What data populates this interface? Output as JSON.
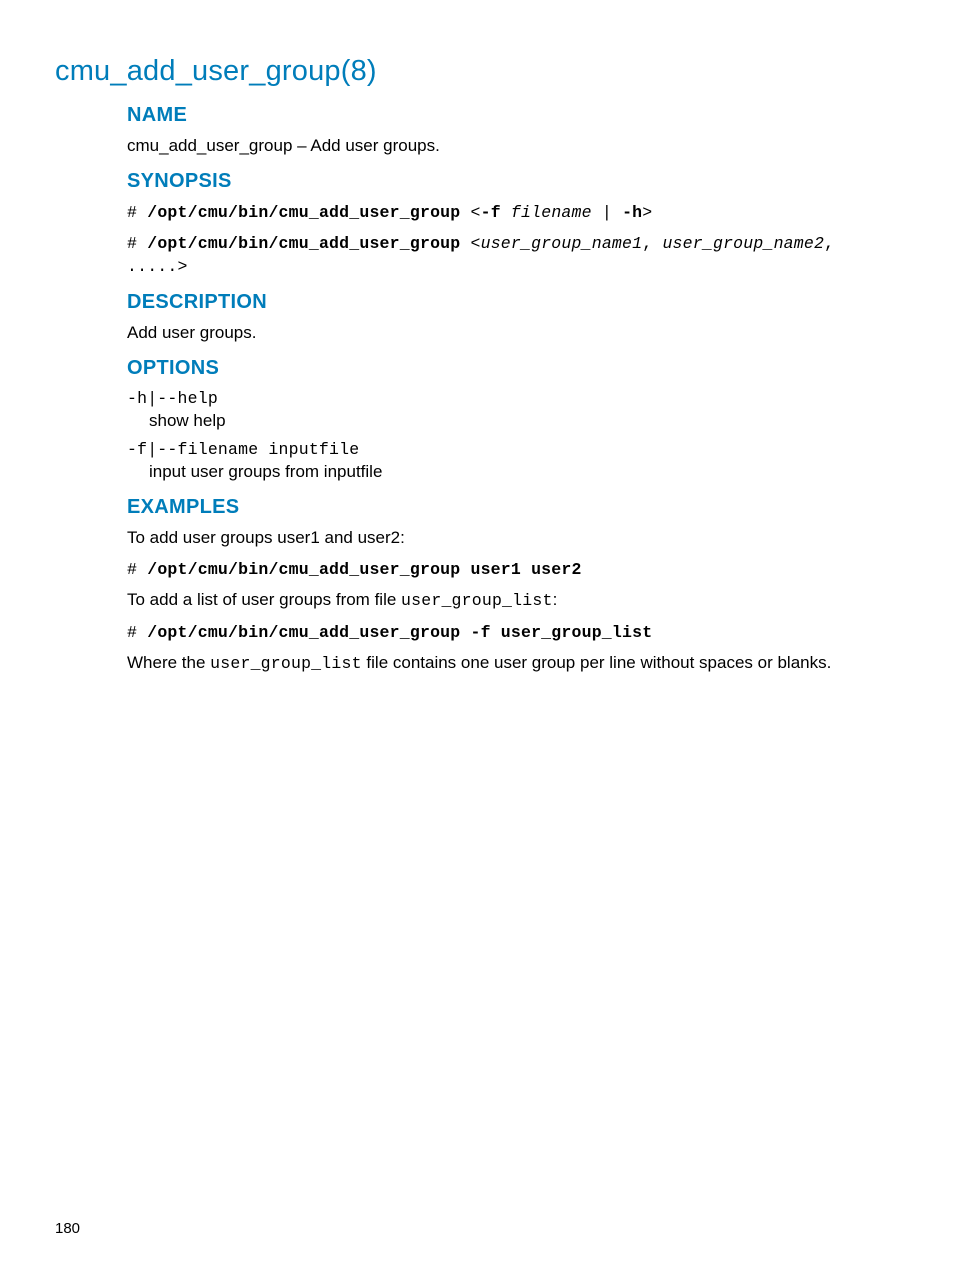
{
  "page_title": "cmu_add_user_group(8)",
  "page_number": "180",
  "sections": {
    "name": {
      "heading": "NAME",
      "text_pre": "cmu_add_user_group – ",
      "text_post": "Add user groups."
    },
    "synopsis": {
      "heading": "SYNOPSIS",
      "lines": [
        {
          "prefix": "# ",
          "cmd": "/opt/cmu/bin/cmu_add_user_group",
          "mid": " <",
          "flag": "-f",
          "space": " ",
          "arg": "filename",
          "bar": " | ",
          "flag2": "-h",
          "end": ">"
        },
        {
          "prefix": "# ",
          "cmd": "/opt/cmu/bin/cmu_add_user_group",
          "mid": " <",
          "arg1": "user_group_name1",
          "comma": ", ",
          "arg2": "user_group_name2",
          "tail": ", .....>"
        }
      ]
    },
    "description": {
      "heading": "DESCRIPTION",
      "text": "Add user groups."
    },
    "options": {
      "heading": "OPTIONS",
      "items": [
        {
          "flag": "-h|--help",
          "desc": "show help"
        },
        {
          "flag": "-f|--filename inputfile",
          "desc": "input user groups from inputfile"
        }
      ]
    },
    "examples": {
      "heading": "EXAMPLES",
      "intro1": "To add user groups user1 and user2:",
      "cmd1_prefix": "# ",
      "cmd1": "/opt/cmu/bin/cmu_add_user_group user1 user2",
      "intro2_pre": "To add a list of user groups from file ",
      "intro2_file": "user_group_list",
      "intro2_post": ":",
      "cmd2_prefix": "# ",
      "cmd2": "/opt/cmu/bin/cmu_add_user_group -f user_group_list",
      "note_pre": "Where the ",
      "note_file": "user_group_list",
      "note_post": " file contains one user group per line without spaces or blanks."
    }
  }
}
